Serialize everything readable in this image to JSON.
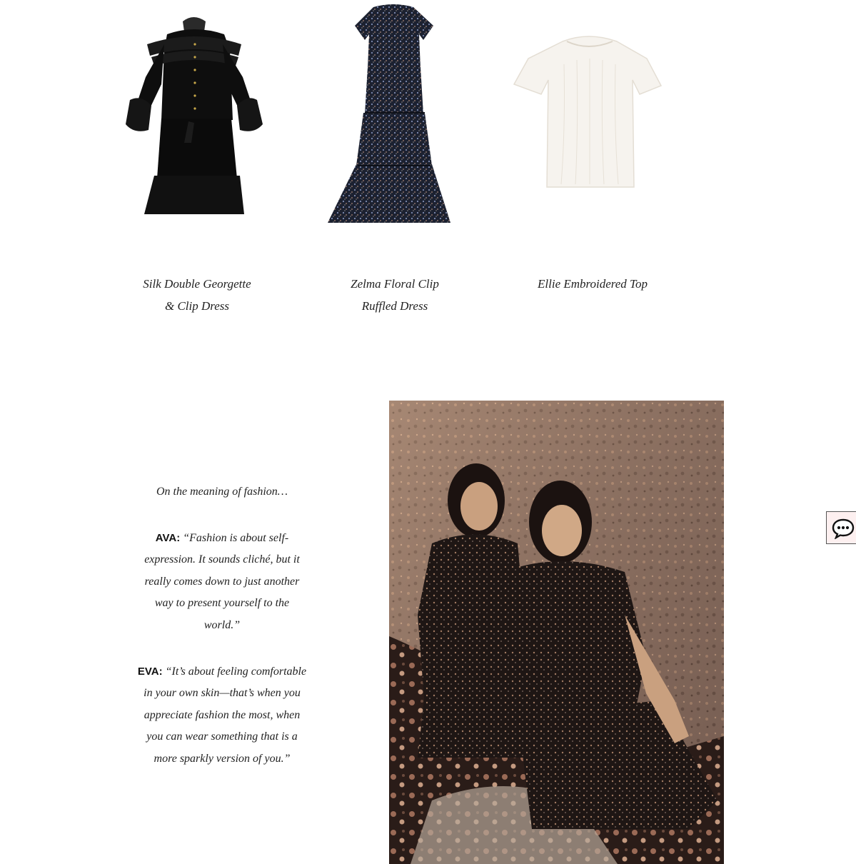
{
  "products": [
    {
      "name_line1": "Silk Double Georgette",
      "name_line2": "& Clip Dress",
      "image_icon": "black-ruffle-dress-image"
    },
    {
      "name_line1": "Zelma Floral Clip",
      "name_line2": "Ruffled Dress",
      "image_icon": "floral-maxi-dress-image"
    },
    {
      "name_line1": "Ellie Embroidered Top",
      "name_line2": "",
      "image_icon": "white-embroidered-top-image"
    }
  ],
  "interview": {
    "intro": "On the meaning of fashion…",
    "quotes": [
      {
        "speaker": "AVA:",
        "text": "“Fashion is about self-expression. It sounds cliché, but it really comes down to just another way to present yourself to the world.”"
      },
      {
        "speaker": "EVA:",
        "text": "“It’s about feeling comfortable in your own skin—that’s when you appreciate fashion the most, when you can wear something that is a more sparkly version of you.”"
      }
    ]
  },
  "photo": {
    "icon": "two-women-floral-dresses-photo"
  },
  "chat_widget": {
    "icon": "chat-bubble-icon"
  },
  "colors": {
    "background": "#ffffff",
    "text": "#222222",
    "chat_bg": "#fdf0f0"
  }
}
